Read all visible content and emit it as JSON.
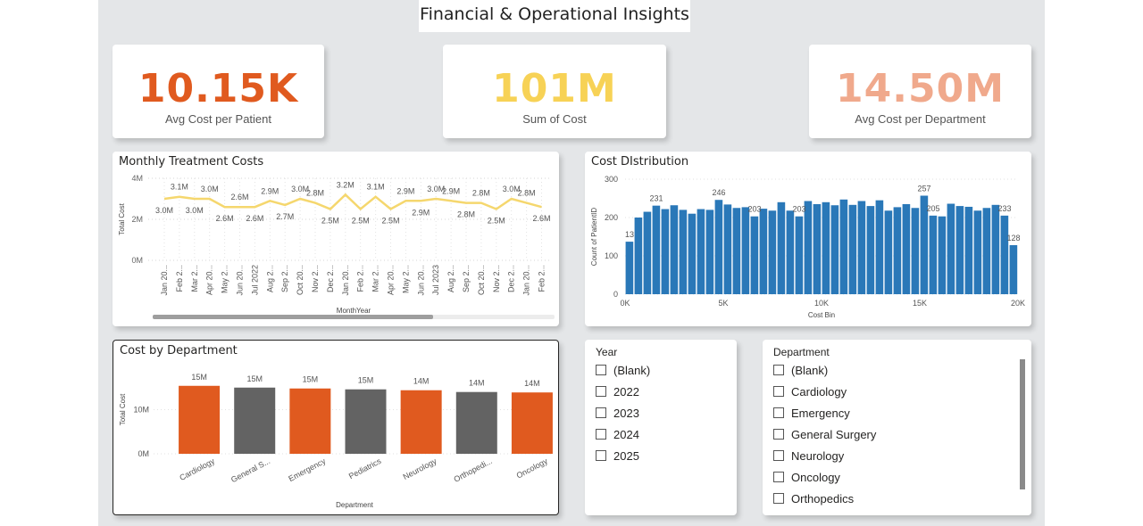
{
  "report": {
    "title": "Financial & Operational Insights"
  },
  "kpis": [
    {
      "value": "10.15K",
      "label": "Avg Cost per Patient",
      "color": "#e05a1f"
    },
    {
      "value": "101M",
      "label": "Sum of Cost",
      "color": "#f7d256"
    },
    {
      "value": "14.50M",
      "label": "Avg Cost per Department",
      "color": "#f0a98c"
    }
  ],
  "monthly_chart": {
    "title": "Monthly Treatment Costs"
  },
  "distribution_chart": {
    "title": "Cost DIstribution"
  },
  "department_chart": {
    "title": "Cost by Department"
  },
  "year_slicer": {
    "title": "Year",
    "items": [
      "(Blank)",
      "2022",
      "2023",
      "2024",
      "2025"
    ]
  },
  "department_slicer": {
    "title": "Department",
    "items": [
      "(Blank)",
      "Cardiology",
      "Emergency",
      "General Surgery",
      "Neurology",
      "Oncology",
      "Orthopedics"
    ]
  },
  "colors": {
    "line": "#f5d76e",
    "bar_blue": "#2a78b8",
    "bar_orange": "#e05a1f",
    "bar_gray": "#636363"
  },
  "chart_data": [
    {
      "type": "line",
      "title": "Monthly Treatment Costs",
      "xlabel": "MonthYear",
      "ylabel": "Total Cost",
      "ylim": [
        0,
        4000000
      ],
      "yticks": [
        "0M",
        "2M",
        "4M"
      ],
      "x_tick_labels": [
        "Jan 20...",
        "Feb 2...",
        "Mar 2...",
        "Apr 20...",
        "May 2...",
        "Jun 20...",
        "Jul 2022",
        "Aug 2...",
        "Sep 2...",
        "Oct 20...",
        "Nov 2...",
        "Dec 2...",
        "Jan 20...",
        "Feb 2...",
        "Mar 2...",
        "Apr 20...",
        "May 2...",
        "Jun 20...",
        "Jul 2023",
        "Aug 2...",
        "Sep 2...",
        "Oct 20...",
        "Nov 2...",
        "Dec 2...",
        "Jan 20...",
        "Feb 2..."
      ],
      "values": [
        3.0,
        3.1,
        3.0,
        3.0,
        2.6,
        2.6,
        2.6,
        2.9,
        2.7,
        3.0,
        2.8,
        2.5,
        3.2,
        2.5,
        3.1,
        2.5,
        2.9,
        2.9,
        3.0,
        2.9,
        2.8,
        2.8,
        2.5,
        3.0,
        2.8,
        2.6
      ],
      "value_unit": "M",
      "data_labels": [
        "3.0M",
        "3.1M",
        "3.0M",
        "3.0M",
        "2.6M",
        "2.6M",
        "2.6M",
        "2.9M",
        "2.7M",
        "3.0M",
        "2.8M",
        "2.5M",
        "3.2M",
        "2.5M",
        "3.1M",
        "2.5M",
        "2.9M",
        "2.9M",
        "3.0M",
        "2.9M",
        "2.8M",
        "2.8M",
        "2.5M",
        "3.0M",
        "2.8M",
        "2.6M"
      ]
    },
    {
      "type": "bar",
      "title": "Cost DIstribution",
      "xlabel": "Cost Bin",
      "ylabel": "Count of PatientID",
      "ylim": [
        0,
        300
      ],
      "yticks": [
        0,
        100,
        200,
        300
      ],
      "xticks": [
        "0K",
        "5K",
        "10K",
        "15K",
        "20K"
      ],
      "xlim": [
        0,
        20000
      ],
      "values": [
        137,
        200,
        215,
        231,
        222,
        232,
        220,
        210,
        222,
        220,
        246,
        234,
        225,
        227,
        203,
        223,
        218,
        240,
        218,
        203,
        243,
        235,
        240,
        232,
        247,
        233,
        243,
        230,
        245,
        218,
        227,
        235,
        225,
        257,
        205,
        203,
        236,
        230,
        228,
        218,
        225,
        233,
        205,
        128
      ],
      "data_labels": {
        "0": "13",
        "3": "231",
        "10": "246",
        "14": "203",
        "19": "203",
        "33": "257",
        "34": "205",
        "42": "233",
        "43": "128"
      }
    },
    {
      "type": "bar",
      "title": "Cost by Department",
      "xlabel": "Department",
      "ylabel": "Total Cost",
      "ylim": [
        0,
        20000000
      ],
      "yticks": [
        "0M",
        "10M"
      ],
      "categories": [
        "Cardiology",
        "General S...",
        "Emergency",
        "Pediatrics",
        "Neurology",
        "Orthopedi...",
        "Oncology"
      ],
      "values": [
        15.4,
        15.0,
        14.8,
        14.6,
        14.4,
        14.0,
        13.9
      ],
      "value_unit": "M",
      "data_labels": [
        "15M",
        "15M",
        "15M",
        "15M",
        "14M",
        "14M",
        "14M"
      ]
    }
  ]
}
